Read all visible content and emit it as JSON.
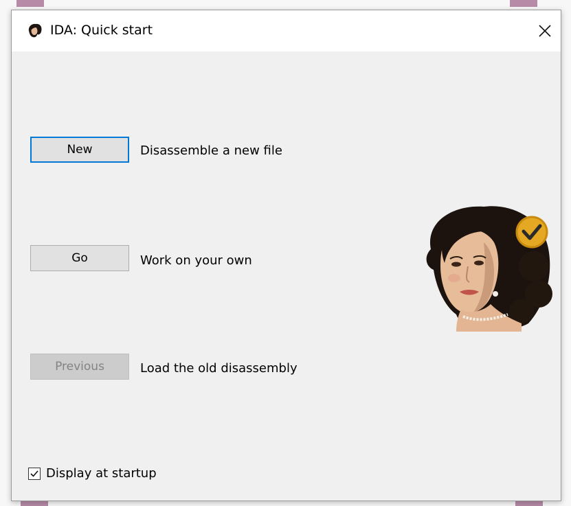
{
  "window": {
    "title": "IDA: Quick start",
    "close_icon": "close-icon",
    "app_icon": "ida-portrait-icon"
  },
  "actions": [
    {
      "button": "New",
      "description": "Disassemble a new file",
      "state": "default"
    },
    {
      "button": "Go",
      "description": "Work on your own",
      "state": "normal"
    },
    {
      "button": "Previous",
      "description": "Load the old disassembly",
      "state": "disabled"
    }
  ],
  "startup": {
    "label": "Display at startup",
    "checked": true
  },
  "colors": {
    "accent": "#0078d7",
    "dialog_bg": "#f0f0f0",
    "disabled_text": "#838383",
    "logo_badge": "#e5a822"
  }
}
